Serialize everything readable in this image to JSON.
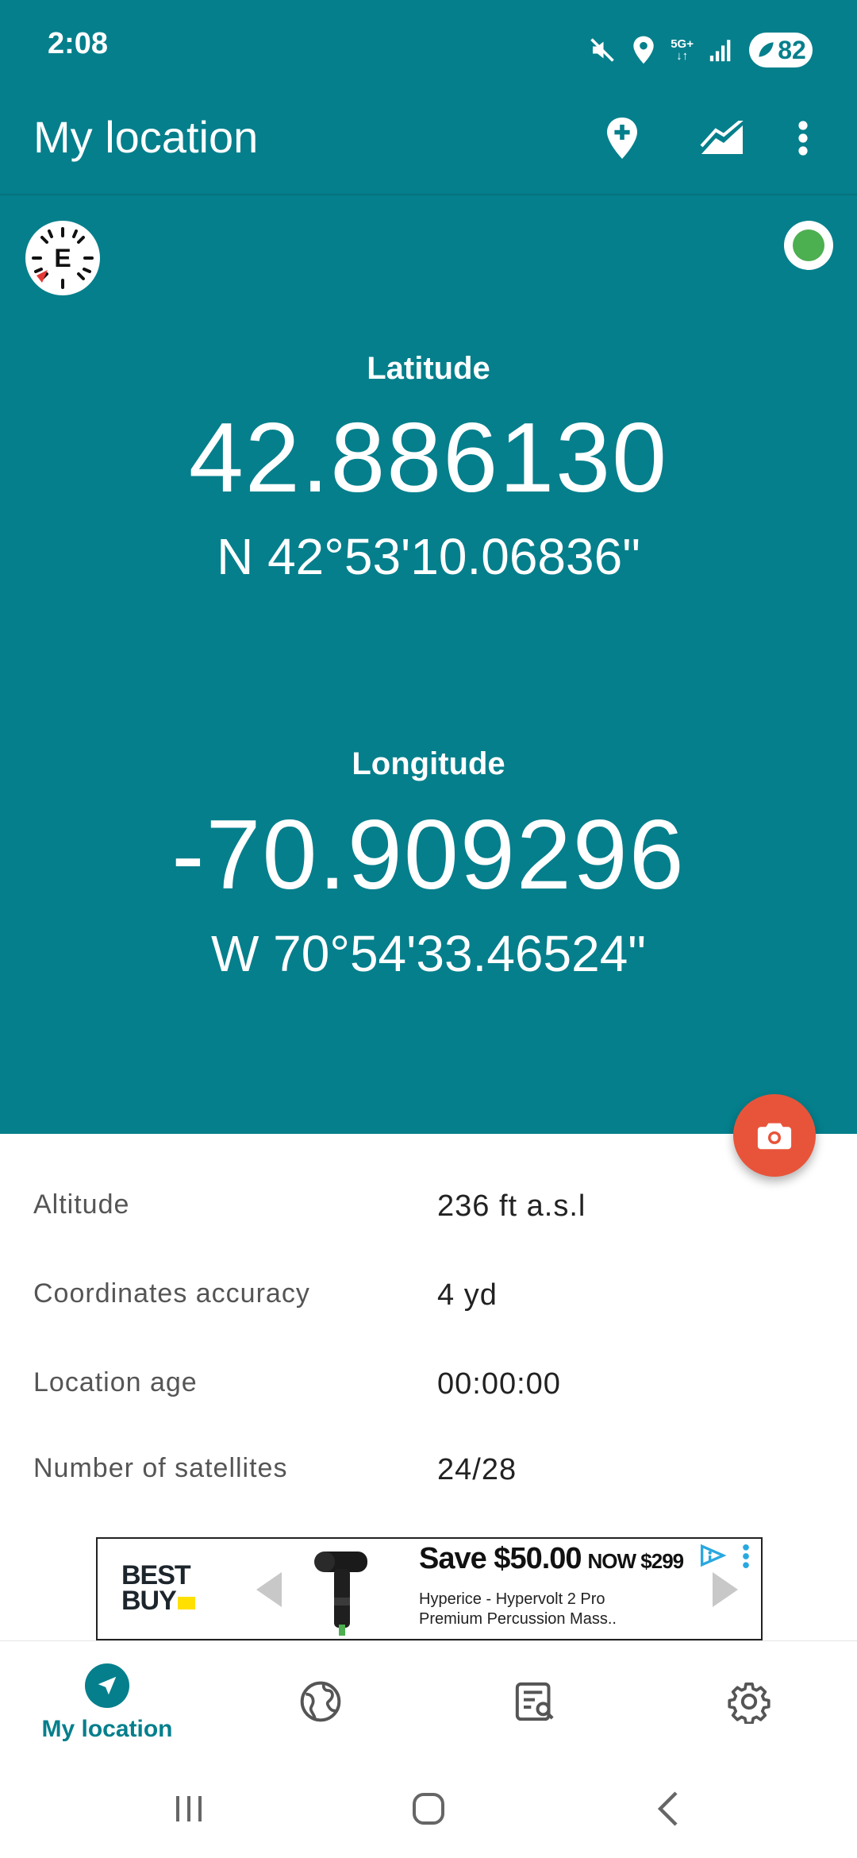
{
  "status_bar": {
    "time": "2:08",
    "network_label_top": "5G+",
    "network_label_bottom": "↓↑",
    "battery": "82",
    "icons": [
      "mute-icon",
      "location-pin-icon",
      "signal-icon",
      "battery-icon"
    ]
  },
  "app_bar": {
    "title": "My location",
    "actions": [
      "add-location-icon",
      "elevation-chart-icon",
      "more-vert-icon"
    ]
  },
  "compass": {
    "letter": "E"
  },
  "coordinates": {
    "latitude": {
      "label": "Latitude",
      "decimal": "42.886130",
      "dms": "N 42°53'10.06836\""
    },
    "longitude": {
      "label": "Longitude",
      "decimal": "-70.909296",
      "dms": "W 70°54'33.46524\""
    }
  },
  "details": [
    {
      "label": "Altitude",
      "value": "236 ft a.s.l"
    },
    {
      "label": "Coordinates accuracy",
      "value": "4 yd"
    },
    {
      "label": "Location age",
      "value": "00:00:00"
    },
    {
      "label": "Number of satellites",
      "value": "24/28"
    }
  ],
  "ad": {
    "brand_line1": "BEST",
    "brand_line2": "BUY",
    "headline": "Save $50.00",
    "headline_now": "NOW $299",
    "description": "Hyperice - Hypervolt 2 Pro Premium Percussion Mass..",
    "icons": [
      "ad-choices-icon",
      "more-vert-icon"
    ]
  },
  "bottom_nav": {
    "items": [
      {
        "label": "My location",
        "icon": "navigation-arrow-icon",
        "active": true
      },
      {
        "label": "",
        "icon": "globe-icon",
        "active": false
      },
      {
        "label": "",
        "icon": "list-search-icon",
        "active": false
      },
      {
        "label": "",
        "icon": "gear-icon",
        "active": false
      }
    ]
  },
  "colors": {
    "primary": "#057f8c",
    "fab": "#e8543a",
    "status_ok": "#4caf50"
  }
}
